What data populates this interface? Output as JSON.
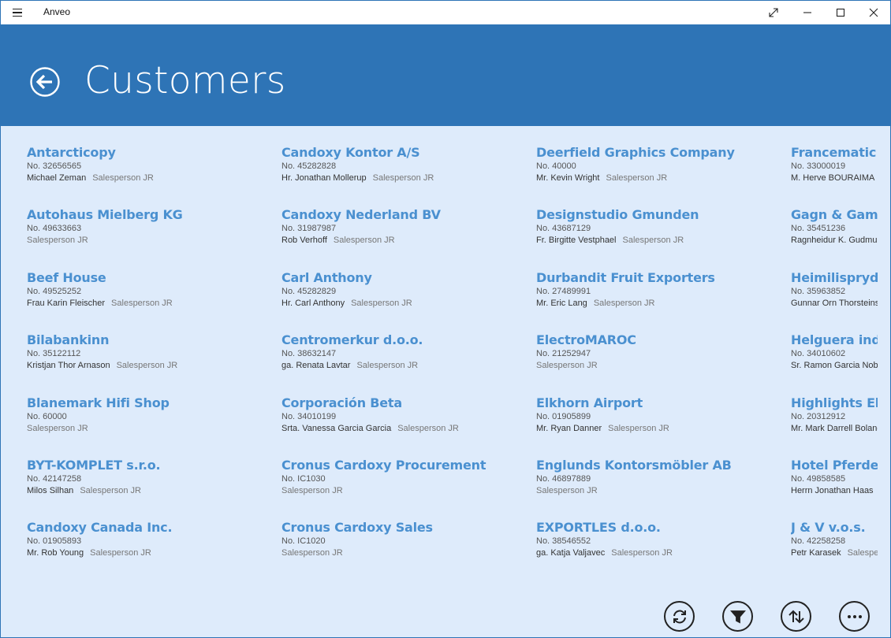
{
  "window": {
    "title": "Anveo"
  },
  "header": {
    "title": "Customers"
  },
  "customers": [
    [
      {
        "name": "Antarcticopy",
        "no": "No. 32656565",
        "contact": "Michael Zeman",
        "salesperson": "Salesperson JR"
      },
      {
        "name": "Autohaus Mielberg KG",
        "no": "No. 49633663",
        "contact": "",
        "salesperson": "Salesperson JR"
      },
      {
        "name": "Beef House",
        "no": "No. 49525252",
        "contact": "Frau Karin Fleischer",
        "salesperson": "Salesperson JR"
      },
      {
        "name": "Bilabankinn",
        "no": "No. 35122112",
        "contact": "Kristjan Thor Arnason",
        "salesperson": "Salesperson JR"
      },
      {
        "name": "Blanemark Hifi Shop",
        "no": "No. 60000",
        "contact": "",
        "salesperson": "Salesperson JR"
      },
      {
        "name": "BYT-KOMPLET s.r.o.",
        "no": "No. 42147258",
        "contact": "Milos Silhan",
        "salesperson": "Salesperson JR"
      },
      {
        "name": "Candoxy Canada Inc.",
        "no": "No. 01905893",
        "contact": "Mr. Rob Young",
        "salesperson": "Salesperson JR"
      }
    ],
    [
      {
        "name": "Candoxy Kontor A/S",
        "no": "No. 45282828",
        "contact": "Hr. Jonathan Mollerup",
        "salesperson": "Salesperson JR"
      },
      {
        "name": "Candoxy Nederland BV",
        "no": "No. 31987987",
        "contact": "Rob Verhoff",
        "salesperson": "Salesperson JR"
      },
      {
        "name": "Carl Anthony",
        "no": "No. 45282829",
        "contact": "Hr. Carl Anthony",
        "salesperson": "Salesperson JR"
      },
      {
        "name": "Centromerkur d.o.o.",
        "no": "No. 38632147",
        "contact": "ga. Renata Lavtar",
        "salesperson": "Salesperson JR"
      },
      {
        "name": "Corporación Beta",
        "no": "No. 34010199",
        "contact": "Srta. Vanessa Garcia Garcia",
        "salesperson": "Salesperson JR"
      },
      {
        "name": "Cronus Cardoxy Procurement",
        "no": "No. IC1030",
        "contact": "",
        "salesperson": "Salesperson JR"
      },
      {
        "name": "Cronus Cardoxy Sales",
        "no": "No. IC1020",
        "contact": "",
        "salesperson": "Salesperson JR"
      }
    ],
    [
      {
        "name": "Deerfield Graphics Company",
        "no": "No. 40000",
        "contact": "Mr. Kevin Wright",
        "salesperson": "Salesperson JR"
      },
      {
        "name": "Designstudio Gmunden",
        "no": "No. 43687129",
        "contact": "Fr. Birgitte Vestphael",
        "salesperson": "Salesperson JR"
      },
      {
        "name": "Durbandit Fruit Exporters",
        "no": "No. 27489991",
        "contact": "Mr. Eric Lang",
        "salesperson": "Salesperson JR"
      },
      {
        "name": "ElectroMAROC",
        "no": "No. 21252947",
        "contact": "",
        "salesperson": "Salesperson JR"
      },
      {
        "name": "Elkhorn Airport",
        "no": "No. 01905899",
        "contact": "Mr. Ryan Danner",
        "salesperson": "Salesperson JR"
      },
      {
        "name": "Englunds Kontorsmöbler AB",
        "no": "No. 46897889",
        "contact": "",
        "salesperson": "Salesperson JR"
      },
      {
        "name": "EXPORTLES d.o.o.",
        "no": "No. 38546552",
        "contact": "ga. Katja Valjavec",
        "salesperson": "Salesperson JR"
      }
    ],
    [
      {
        "name": "Francematic",
        "no": "No. 33000019",
        "contact": "M. Herve BOURAIMA",
        "salesperson": ""
      },
      {
        "name": "Gagn & Gaman",
        "no": "No. 35451236",
        "contact": "Ragnheidur K. Gudmundsdottir",
        "salesperson": ""
      },
      {
        "name": "Heimilisprydi",
        "no": "No. 35963852",
        "contact": "Gunnar Orn Thorsteinsson",
        "salesperson": ""
      },
      {
        "name": "Helguera industrial",
        "no": "No. 34010602",
        "contact": "Sr. Ramon Garcia Nobleza",
        "salesperson": ""
      },
      {
        "name": "Highlights Electronics",
        "no": "No. 20312912",
        "contact": "Mr. Mark Darrell Boland",
        "salesperson": ""
      },
      {
        "name": "Hotel Pferdesee",
        "no": "No. 49858585",
        "contact": "Herrn Jonathan Haas",
        "salesperson": ""
      },
      {
        "name": "J & V v.o.s.",
        "no": "No. 42258258",
        "contact": "Petr Karasek",
        "salesperson": "Salesperson JR"
      }
    ]
  ]
}
